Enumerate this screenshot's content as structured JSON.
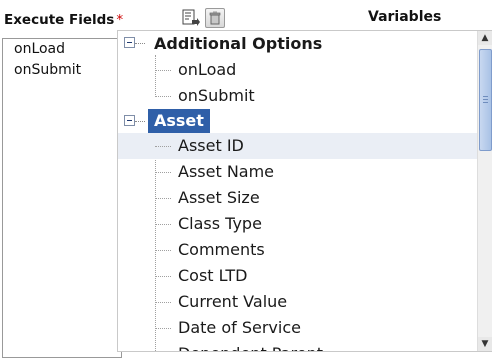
{
  "header": {
    "label": "Execute Fields",
    "required_marker": "*",
    "variables_label": "Variables"
  },
  "icons": {
    "copy": "copy-icon",
    "trash": "trash-icon"
  },
  "execute_list": {
    "items": [
      "onLoad",
      "onSubmit"
    ]
  },
  "tree": {
    "groups": [
      {
        "label": "Additional Options",
        "children": [
          "onLoad",
          "onSubmit"
        ]
      },
      {
        "label": "Asset",
        "children": [
          "Asset ID",
          "Asset Name",
          "Asset Size",
          "Class Type",
          "Comments",
          "Cost LTD",
          "Current Value",
          "Date of Service",
          "Dependent Parent"
        ]
      }
    ],
    "selected_group": "Asset",
    "hovered_item": "Asset ID"
  },
  "colors": {
    "selection": "#2f5fa8",
    "hover_row": "#eaeef5",
    "required": "#cc0000"
  }
}
